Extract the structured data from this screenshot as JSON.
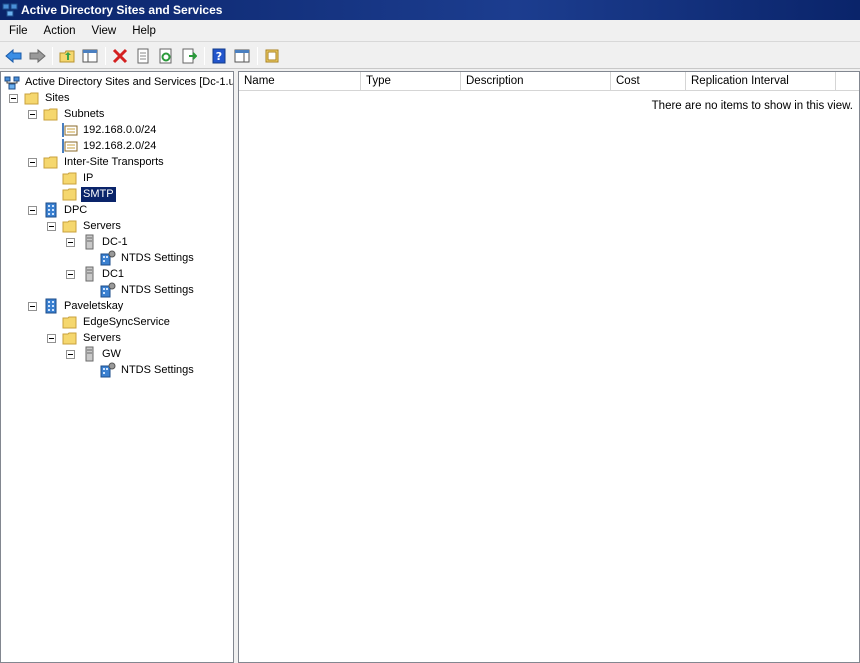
{
  "window": {
    "title": "Active Directory Sites and Services"
  },
  "menu": [
    {
      "label": "File"
    },
    {
      "label": "Action"
    },
    {
      "label": "View"
    },
    {
      "label": "Help"
    }
  ],
  "toolbar": {
    "buttons": [
      "back-icon",
      "forward-icon",
      "up-folder-icon",
      "show-hide-tree-icon",
      "delete-icon",
      "properties-icon",
      "refresh-icon",
      "export-list-icon",
      "help-icon",
      "show-action-pane-icon",
      "console-icon"
    ]
  },
  "tree": {
    "root": "Active Directory Sites and Services [Dc-1.u",
    "sites": "Sites",
    "subnets": "Subnets",
    "subnet1": "192.168.0.0/24",
    "subnet2": "192.168.2.0/24",
    "transports": "Inter-Site Transports",
    "ip": "IP",
    "smtp": "SMTP",
    "dpc": "DPC",
    "dpc_servers": "Servers",
    "dc_1": "DC-1",
    "dc_1_ntds": "NTDS Settings",
    "dc1": "DC1",
    "dc1_ntds": "NTDS Settings",
    "pav": "Paveletskay",
    "edgesync": "EdgeSyncService",
    "pav_servers": "Servers",
    "gw": "GW",
    "gw_ntds": "NTDS Settings"
  },
  "list": {
    "columns": [
      "Name",
      "Type",
      "Description",
      "Cost",
      "Replication Interval"
    ],
    "empty_message": "There are no items to show in this view."
  },
  "colors": {
    "title_bg": "#0a246a",
    "selection": "#0a246a",
    "folder": "#f5d76e"
  }
}
